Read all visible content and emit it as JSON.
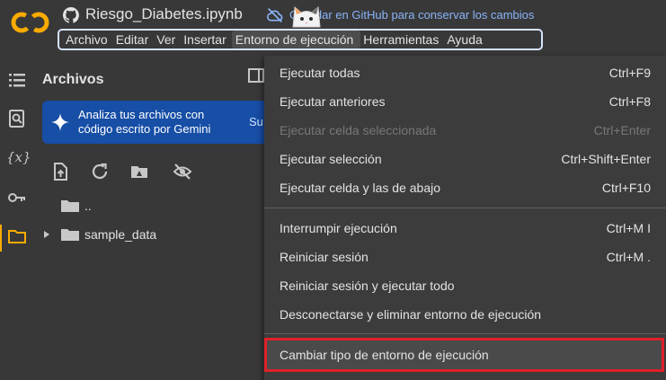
{
  "app": {
    "title": "Riesgo_Diabetes.ipynb",
    "save_notice": "Guardar en GitHub para conservar los cambios",
    "logo": "colab-logo",
    "colors": {
      "accent": "#f9ab00",
      "highlight_border": "#e0202a",
      "banner": "#174ea6",
      "link": "#8ab4f8"
    }
  },
  "menubar": [
    {
      "label": "Archivo"
    },
    {
      "label": "Editar"
    },
    {
      "label": "Ver"
    },
    {
      "label": "Insertar"
    },
    {
      "label": "Entorno de ejecución"
    },
    {
      "label": "Herramientas"
    },
    {
      "label": "Ayuda"
    }
  ],
  "sidebar": {
    "icons": [
      "toc-icon",
      "search-icon",
      "variables-icon",
      "key-icon",
      "folder-icon"
    ],
    "variables_glyph": "{x}"
  },
  "files": {
    "title": "Archivos",
    "gemini_banner": {
      "text": "Analiza tus archivos con código escrito por Gemini",
      "more": "Su"
    },
    "toolbar_icons": [
      "upload-icon",
      "refresh-icon",
      "drive-icon",
      "hide-icon"
    ],
    "tree": [
      {
        "label": ".."
      },
      {
        "label": "sample_data"
      }
    ]
  },
  "dropdown": {
    "groups": [
      [
        {
          "label": "Ejecutar todas",
          "shortcut": "Ctrl+F9",
          "disabled": false
        },
        {
          "label": "Ejecutar anteriores",
          "shortcut": "Ctrl+F8",
          "disabled": false
        },
        {
          "label": "Ejecutar celda seleccionada",
          "shortcut": "Ctrl+Enter",
          "disabled": true
        },
        {
          "label": "Ejecutar selección",
          "shortcut": "Ctrl+Shift+Enter",
          "disabled": false
        },
        {
          "label": "Ejecutar celda y las de abajo",
          "shortcut": "Ctrl+F10",
          "disabled": false
        }
      ],
      [
        {
          "label": "Interrumpir ejecución",
          "shortcut": "Ctrl+M I",
          "disabled": false
        },
        {
          "label": "Reiniciar sesión",
          "shortcut": "Ctrl+M .",
          "disabled": false
        },
        {
          "label": "Reiniciar sesión y ejecutar todo",
          "shortcut": "",
          "disabled": false
        },
        {
          "label": "Desconectarse y eliminar entorno de ejecución",
          "shortcut": "",
          "disabled": false
        }
      ],
      [
        {
          "label": "Cambiar tipo de entorno de ejecución",
          "shortcut": "",
          "disabled": false,
          "highlighted": true
        }
      ]
    ]
  }
}
